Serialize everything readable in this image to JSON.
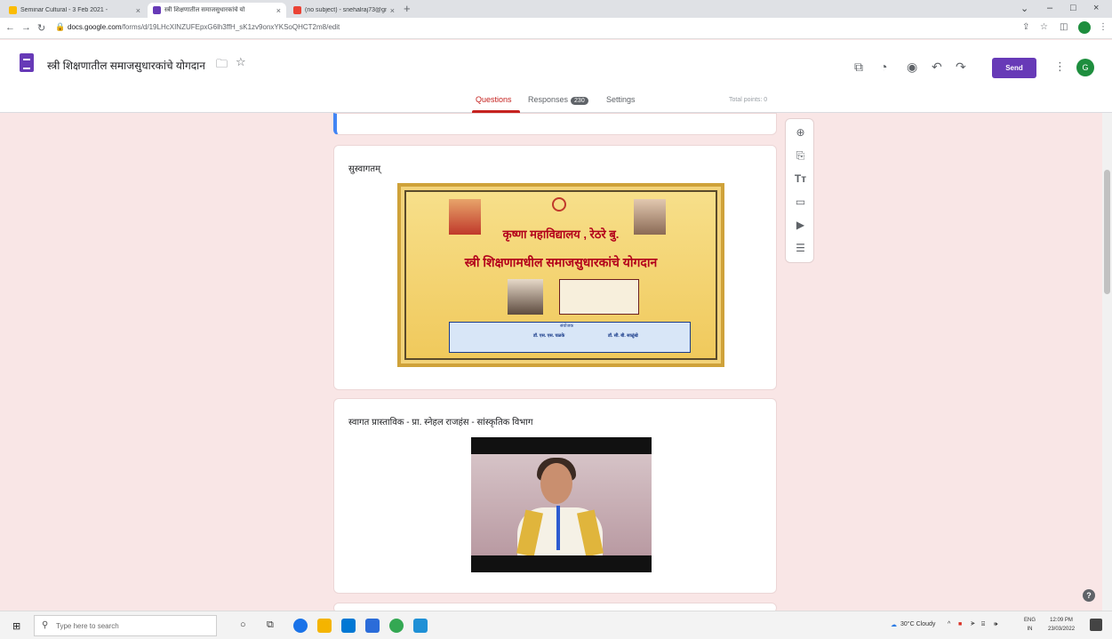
{
  "browser": {
    "tabs": [
      {
        "label": "Seminar Cultural - 3 Feb 2021 -",
        "color": "#fbbc04"
      },
      {
        "label": "स्त्री शिक्षणातील समाजसुधारकांचे यो",
        "color": "#673ab7"
      },
      {
        "label": "(no subject) - snehalraj73@gmai",
        "color": "#ea4335"
      }
    ],
    "url_prefix": "docs.google.com",
    "url_rest": "/forms/d/19LHcXINZUFEpxG6lh3ffH_sK1zv9onxYKSoQHCT2m8/edit"
  },
  "form": {
    "title": "स्त्री शिक्षणातील समाजसुधारकांचे योगदान",
    "send_label": "Send",
    "avatar_letter": "G",
    "tabs": {
      "questions": "Questions",
      "responses": "Responses",
      "responses_count": "230",
      "settings": "Settings"
    },
    "total_points": "Total points: 0"
  },
  "cards": {
    "welcome_title": "सुस्वागतम्",
    "video_title": "स्वागत प्रास्ताविक - प्रा. स्नेहल राजहंस - सांस्कृतिक विभाग"
  },
  "poster": {
    "college": "कृष्णा महाविद्यालय , रेठरे बु.",
    "topic": "स्त्री शिक्षणामधील समाजसुधारकांचे योगदान",
    "organizer_label": "संयोजक",
    "coord1": "डॉ. एस. एस. घळके",
    "coord2": "डॉ. सी. बी. साळुंखे"
  },
  "taskbar": {
    "search_placeholder": "Type here to search",
    "weather": "30°C Cloudy",
    "lang": "ENG",
    "region": "IN",
    "time": "12:09 PM",
    "date": "23/03/2022"
  }
}
